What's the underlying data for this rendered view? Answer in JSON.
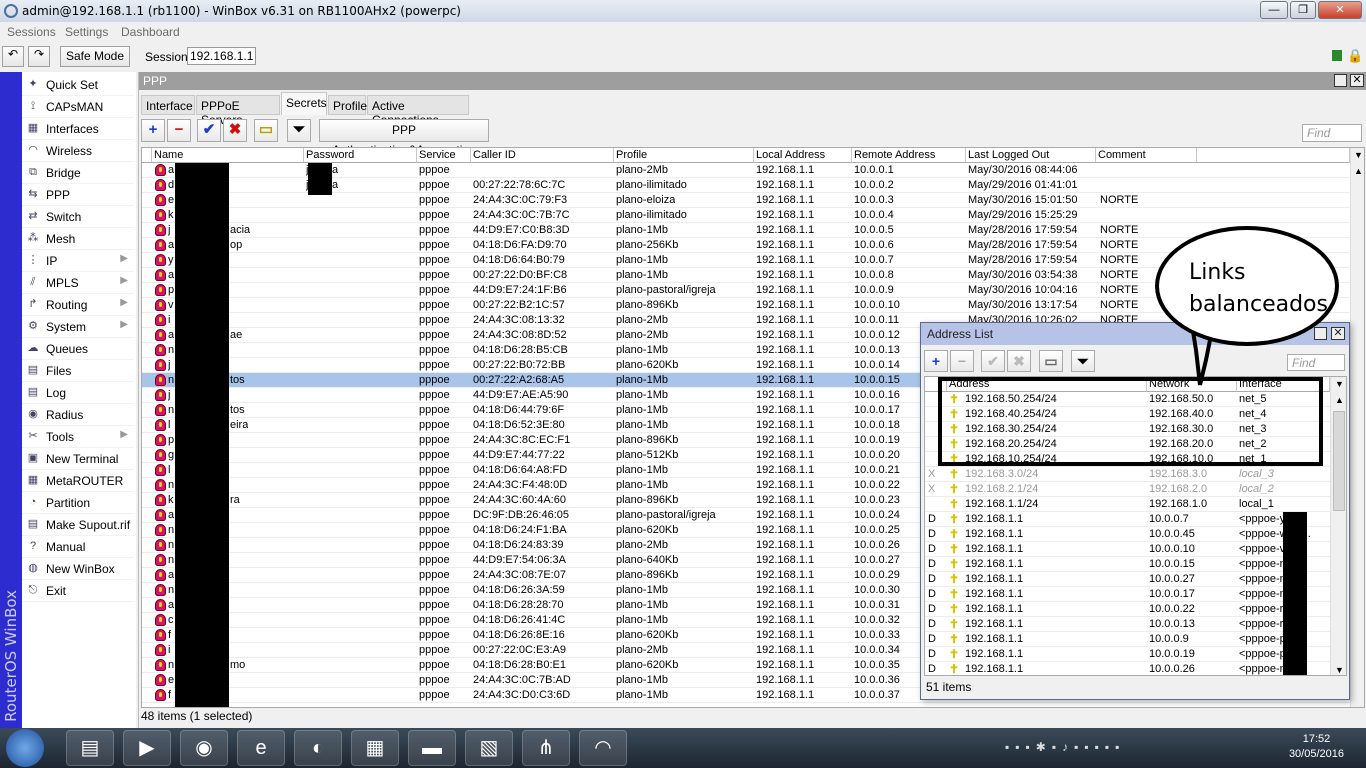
{
  "window": {
    "title": "admin@192.168.1.1 (rb1100) - WinBox v6.31 on RB1100AHx2 (powerpc)"
  },
  "menu": [
    "Sessions",
    "Settings",
    "Dashboard"
  ],
  "toolbar": {
    "safe_mode": "Safe Mode",
    "session_label": "Session:",
    "session_value": "192.168.1.1"
  },
  "sidebar": {
    "brand": "RouterOS WinBox",
    "items": [
      {
        "label": "Quick Set",
        "icon": "wand-icon"
      },
      {
        "label": "CAPsMAN",
        "icon": "antenna-icon"
      },
      {
        "label": "Interfaces",
        "icon": "interfaces-icon"
      },
      {
        "label": "Wireless",
        "icon": "wireless-icon"
      },
      {
        "label": "Bridge",
        "icon": "bridge-icon"
      },
      {
        "label": "PPP",
        "icon": "ppp-icon"
      },
      {
        "label": "Switch",
        "icon": "switch-icon"
      },
      {
        "label": "Mesh",
        "icon": "mesh-icon"
      },
      {
        "label": "IP",
        "icon": "ip-icon",
        "submenu": true
      },
      {
        "label": "MPLS",
        "icon": "mpls-icon",
        "submenu": true
      },
      {
        "label": "Routing",
        "icon": "routing-icon",
        "submenu": true
      },
      {
        "label": "System",
        "icon": "gear-icon",
        "submenu": true
      },
      {
        "label": "Queues",
        "icon": "queues-icon"
      },
      {
        "label": "Files",
        "icon": "folder-icon"
      },
      {
        "label": "Log",
        "icon": "log-icon"
      },
      {
        "label": "Radius",
        "icon": "radius-icon"
      },
      {
        "label": "Tools",
        "icon": "tools-icon",
        "submenu": true
      },
      {
        "label": "New Terminal",
        "icon": "terminal-icon"
      },
      {
        "label": "MetaROUTER",
        "icon": "metarouter-icon"
      },
      {
        "label": "Partition",
        "icon": "partition-icon"
      },
      {
        "label": "Make Supout.rif",
        "icon": "supout-icon"
      },
      {
        "label": "Manual",
        "icon": "manual-icon"
      },
      {
        "label": "New WinBox",
        "icon": "winbox-icon"
      },
      {
        "label": "Exit",
        "icon": "exit-icon"
      }
    ]
  },
  "ppp": {
    "title": "PPP",
    "tabs": [
      "Interface",
      "PPPoE Servers",
      "Secrets",
      "Profiles",
      "Active Connections"
    ],
    "active_tab": "Secrets",
    "auth_button": "PPP Authentication&Accounting",
    "find_placeholder": "Find",
    "columns": [
      "Name",
      "Password",
      "Service",
      "Caller ID",
      "Profile",
      "Local Address",
      "Remote Address",
      "Last Logged Out",
      "Comment"
    ],
    "rows": [
      [
        "a",
        "",
        "j",
        "a",
        "pppoe",
        "",
        "plano-2Mb",
        "192.168.1.1",
        "10.0.0.1",
        "May/30/2016 08:44:06",
        ""
      ],
      [
        "d",
        "",
        "j",
        "a",
        "pppoe",
        "00:27:22:78:6C:7C",
        "plano-ilimitado",
        "192.168.1.1",
        "10.0.0.2",
        "May/29/2016 01:41:01",
        ""
      ],
      [
        "e",
        "",
        "",
        "",
        "pppoe",
        "24:A4:3C:0C:79:F3",
        "plano-eloiza",
        "192.168.1.1",
        "10.0.0.3",
        "May/30/2016 15:01:50",
        "NORTE"
      ],
      [
        "k",
        "",
        "",
        "",
        "pppoe",
        "24:A4:3C:0C:7B:7C",
        "plano-ilimitado",
        "192.168.1.1",
        "10.0.0.4",
        "May/29/2016 15:25:29",
        ""
      ],
      [
        "j",
        "acia",
        "",
        "",
        "pppoe",
        "44:D9:E7:C0:B8:3D",
        "plano-1Mb",
        "192.168.1.1",
        "10.0.0.5",
        "May/28/2016 17:59:54",
        "NORTE"
      ],
      [
        "a",
        "op",
        "",
        "",
        "pppoe",
        "04:18:D6:FA:D9:70",
        "plano-256Kb",
        "192.168.1.1",
        "10.0.0.6",
        "May/28/2016 17:59:54",
        "NORTE"
      ],
      [
        "y",
        "",
        "",
        "",
        "pppoe",
        "04:18:D6:64:B0:79",
        "plano-1Mb",
        "192.168.1.1",
        "10.0.0.7",
        "May/28/2016 17:59:54",
        "NORTE"
      ],
      [
        "a",
        "",
        "",
        "",
        "pppoe",
        "00:27:22:D0:BF:C8",
        "plano-1Mb",
        "192.168.1.1",
        "10.0.0.8",
        "May/30/2016 03:54:38",
        "NORTE"
      ],
      [
        "p",
        "",
        "",
        "",
        "pppoe",
        "44:D9:E7:24:1F:B6",
        "plano-pastoral/igreja",
        "192.168.1.1",
        "10.0.0.9",
        "May/30/2016 10:04:16",
        "NORTE"
      ],
      [
        "v",
        "",
        "",
        "",
        "pppoe",
        "00:27:22:B2:1C:57",
        "plano-896Kb",
        "192.168.1.1",
        "10.0.0.10",
        "May/30/2016 13:17:54",
        "NORTE"
      ],
      [
        "i",
        "",
        "",
        "",
        "pppoe",
        "24:A4:3C:08:13:32",
        "plano-2Mb",
        "192.168.1.1",
        "10.0.0.11",
        "May/30/2016 10:26:02",
        "NORTE"
      ],
      [
        "a",
        "ae",
        "",
        "",
        "pppoe",
        "24:A4:3C:08:8D:52",
        "plano-2Mb",
        "192.168.1.1",
        "10.0.0.12",
        "",
        ""
      ],
      [
        "n",
        "",
        "",
        "",
        "pppoe",
        "04:18:D6:28:B5:CB",
        "plano-1Mb",
        "192.168.1.1",
        "10.0.0.13",
        "",
        ""
      ],
      [
        "j",
        "",
        "",
        "",
        "pppoe",
        "00:27:22:B0:72:BB",
        "plano-620Kb",
        "192.168.1.1",
        "10.0.0.14",
        "",
        ""
      ],
      [
        "n",
        "tos",
        "",
        "",
        "pppoe",
        "00:27:22:A2:68:A5",
        "plano-1Mb",
        "192.168.1.1",
        "10.0.0.15",
        "",
        ""
      ],
      [
        "j",
        "",
        "",
        "",
        "pppoe",
        "44:D9:E7:AE:A5:90",
        "plano-1Mb",
        "192.168.1.1",
        "10.0.0.16",
        "",
        ""
      ],
      [
        "n",
        "tos",
        "",
        "",
        "pppoe",
        "04:18:D6:44:79:6F",
        "plano-1Mb",
        "192.168.1.1",
        "10.0.0.17",
        "",
        ""
      ],
      [
        "l",
        "eira",
        "",
        "",
        "pppoe",
        "04:18:D6:52:3E:80",
        "plano-1Mb",
        "192.168.1.1",
        "10.0.0.18",
        "",
        ""
      ],
      [
        "p",
        "",
        "",
        "",
        "pppoe",
        "24:A4:3C:8C:EC:F1",
        "plano-896Kb",
        "192.168.1.1",
        "10.0.0.19",
        "",
        ""
      ],
      [
        "g",
        "",
        "",
        "",
        "pppoe",
        "44:D9:E7:44:77:22",
        "plano-512Kb",
        "192.168.1.1",
        "10.0.0.20",
        "",
        ""
      ],
      [
        "l",
        "",
        "",
        "",
        "pppoe",
        "04:18:D6:64:A8:FD",
        "plano-1Mb",
        "192.168.1.1",
        "10.0.0.21",
        "",
        ""
      ],
      [
        "n",
        "",
        "",
        "",
        "pppoe",
        "24:A4:3C:F4:48:0D",
        "plano-1Mb",
        "192.168.1.1",
        "10.0.0.22",
        "",
        ""
      ],
      [
        "k",
        "ra",
        "",
        "",
        "pppoe",
        "24:A4:3C:60:4A:60",
        "plano-896Kb",
        "192.168.1.1",
        "10.0.0.23",
        "",
        ""
      ],
      [
        "a",
        "",
        "",
        "",
        "pppoe",
        "DC:9F:DB:26:46:05",
        "plano-pastoral/igreja",
        "192.168.1.1",
        "10.0.0.24",
        "",
        ""
      ],
      [
        "n",
        "",
        "",
        "",
        "pppoe",
        "04:18:D6:24:F1:BA",
        "plano-620Kb",
        "192.168.1.1",
        "10.0.0.25",
        "",
        ""
      ],
      [
        "n",
        "",
        "",
        "",
        "pppoe",
        "04:18:D6:24:83:39",
        "plano-2Mb",
        "192.168.1.1",
        "10.0.0.26",
        "",
        ""
      ],
      [
        "n",
        "",
        "",
        "",
        "pppoe",
        "44:D9:E7:54:06:3A",
        "plano-640Kb",
        "192.168.1.1",
        "10.0.0.27",
        "",
        ""
      ],
      [
        "a",
        "",
        "",
        "",
        "pppoe",
        "24:A4:3C:08:7E:07",
        "plano-896Kb",
        "192.168.1.1",
        "10.0.0.29",
        "",
        ""
      ],
      [
        "n",
        "",
        "",
        "",
        "pppoe",
        "04:18:D6:26:3A:59",
        "plano-1Mb",
        "192.168.1.1",
        "10.0.0.30",
        "",
        ""
      ],
      [
        "a",
        "",
        "",
        "",
        "pppoe",
        "04:18:D6:28:28:70",
        "plano-1Mb",
        "192.168.1.1",
        "10.0.0.31",
        "",
        ""
      ],
      [
        "c",
        "",
        "",
        "",
        "pppoe",
        "04:18:D6:26:41:4C",
        "plano-1Mb",
        "192.168.1.1",
        "10.0.0.32",
        "",
        ""
      ],
      [
        "f",
        "",
        "",
        "",
        "pppoe",
        "04:18:D6:26:8E:16",
        "plano-620Kb",
        "192.168.1.1",
        "10.0.0.33",
        "",
        ""
      ],
      [
        "i",
        "",
        "",
        "",
        "pppoe",
        "00:27:22:0C:E3:A9",
        "plano-2Mb",
        "192.168.1.1",
        "10.0.0.34",
        "",
        ""
      ],
      [
        "n",
        "mo",
        "",
        "",
        "pppoe",
        "04:18:D6:28:B0:E1",
        "plano-620Kb",
        "192.168.1.1",
        "10.0.0.35",
        "",
        ""
      ],
      [
        "e",
        "",
        "",
        "",
        "pppoe",
        "24:A4:3C:0C:7B:AD",
        "plano-1Mb",
        "192.168.1.1",
        "10.0.0.36",
        "",
        ""
      ],
      [
        "f",
        "",
        "",
        "",
        "pppoe",
        "24:A4:3C:D0:C3:6D",
        "plano-1Mb",
        "192.168.1.1",
        "10.0.0.37",
        "",
        ""
      ]
    ],
    "selected_row": 14,
    "status": "48 items (1 selected)"
  },
  "address_list": {
    "title": "Address List",
    "find_placeholder": "Find",
    "columns": [
      "Address",
      "Network",
      "Interface"
    ],
    "rows": [
      {
        "flag": "",
        "address": "192.168.50.254/24",
        "network": "192.168.50.0",
        "interface": "net_5"
      },
      {
        "flag": "",
        "address": "192.168.40.254/24",
        "network": "192.168.40.0",
        "interface": "net_4"
      },
      {
        "flag": "",
        "address": "192.168.30.254/24",
        "network": "192.168.30.0",
        "interface": "net_3"
      },
      {
        "flag": "",
        "address": "192.168.20.254/24",
        "network": "192.168.20.0",
        "interface": "net_2"
      },
      {
        "flag": "",
        "address": "192.168.10.254/24",
        "network": "192.168.10.0",
        "interface": "net_1"
      },
      {
        "flag": "X",
        "address": "192.168.3.0/24",
        "network": "192.168.3.0",
        "interface": "local_3"
      },
      {
        "flag": "X",
        "address": "192.168.2.1/24",
        "network": "192.168.2.0",
        "interface": "local_2"
      },
      {
        "flag": "",
        "address": "192.168.1.1/24",
        "network": "192.168.1.0",
        "interface": "local_1"
      },
      {
        "flag": "D",
        "address": "192.168.1.1",
        "network": "10.0.0.7",
        "interface": "<pppoe-y       ra>"
      },
      {
        "flag": "D",
        "address": "192.168.1.1",
        "network": "10.0.0.45",
        "interface": "<pppoe-w       ss..."
      },
      {
        "flag": "D",
        "address": "192.168.1.1",
        "network": "10.0.0.10",
        "interface": "<pppoe-v        >"
      },
      {
        "flag": "D",
        "address": "192.168.1.1",
        "network": "10.0.0.15",
        "interface": "<pppoe-n       n-..."
      },
      {
        "flag": "D",
        "address": "192.168.1.1",
        "network": "10.0.0.27",
        "interface": "<pppoe-n       e>"
      },
      {
        "flag": "D",
        "address": "192.168.1.1",
        "network": "10.0.0.17",
        "interface": "<pppoe-n       o-..."
      },
      {
        "flag": "D",
        "address": "192.168.1.1",
        "network": "10.0.0.22",
        "interface": "<pppoe-r       o>"
      },
      {
        "flag": "D",
        "address": "192.168.1.1",
        "network": "10.0.0.13",
        "interface": "<pppoe-r       a..."
      },
      {
        "flag": "D",
        "address": "192.168.1.1",
        "network": "10.0.0.9",
        "interface": "<pppoe-p       al>"
      },
      {
        "flag": "D",
        "address": "192.168.1.1",
        "network": "10.0.0.19",
        "interface": "<pppoe-p       ui..."
      },
      {
        "flag": "D",
        "address": "192.168.1.1",
        "network": "10.0.0.26",
        "interface": "<pppoe-n       >"
      }
    ],
    "status": "51 items"
  },
  "annotation": {
    "line1": "Links",
    "line2": "balanceados"
  },
  "taskbar": {
    "time": "17:52",
    "date": "30/05/2016",
    "apps": [
      "explorer-icon",
      "media-player-icon",
      "chrome-icon",
      "ie-icon",
      "firefox-icon",
      "control-panel-icon",
      "toolbox-icon",
      "photo-viewer-icon",
      "winbox-app-icon",
      "network-app-icon"
    ]
  },
  "colors": {
    "sidebar_strip": "#2c2ccf",
    "selected_row": "#a8c4e8",
    "add": "#1a3ccf",
    "remove": "#d01010",
    "user_icon": "#d0157a"
  }
}
